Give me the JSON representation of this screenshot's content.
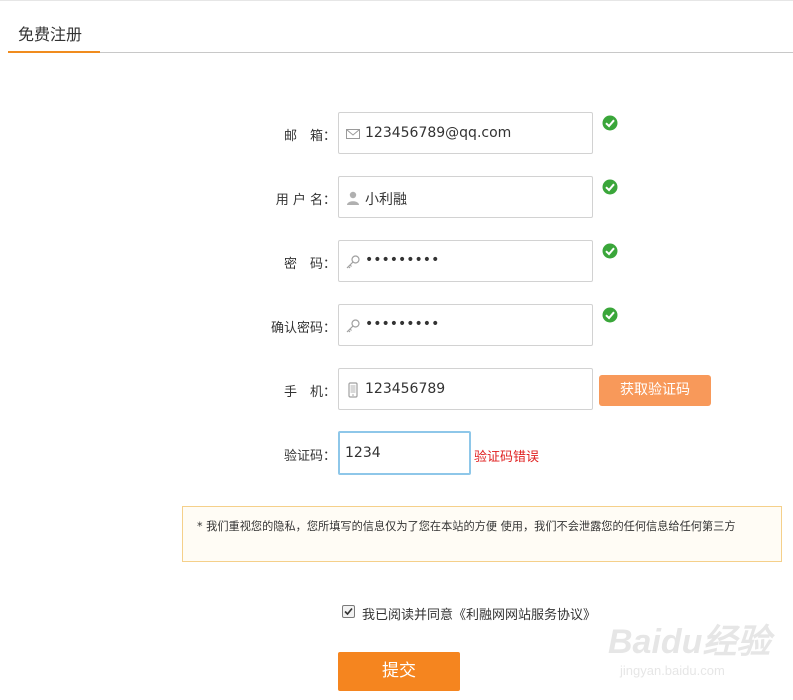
{
  "header": {
    "title": "免费注册"
  },
  "form": {
    "email": {
      "label": "邮　箱：",
      "value": "123456789@qq.com",
      "icon": "envelope-icon",
      "status": "valid"
    },
    "username": {
      "label": "用 户 名：",
      "value": "小利融",
      "icon": "user-icon",
      "status": "valid"
    },
    "password": {
      "label": "密　码：",
      "value": "•••••••••",
      "icon": "key-icon",
      "status": "valid"
    },
    "confirm_password": {
      "label": "确认密码：",
      "value": "•••••••••",
      "icon": "key-icon",
      "status": "valid"
    },
    "phone": {
      "label": "手　机：",
      "value": "123456789",
      "icon": "mobile-phone-icon",
      "button": "获取验证码"
    },
    "captcha": {
      "label": "验证码：",
      "value": "1234",
      "error": "验证码错误"
    }
  },
  "notice": {
    "text": "* 我们重视您的隐私，您所填写的信息仅为了您在本站的方便 使用，我们不会泄露您的任何信息给任何第三方"
  },
  "agreement": {
    "text": "我已阅读并同意《利融网网站服务协议》",
    "checked": true
  },
  "submit": {
    "label": "提交"
  },
  "watermark": {
    "logo": "Baidu经验",
    "url": "jingyan.baidu.com"
  },
  "colors": {
    "accent": "#f5851f",
    "sms_button": "#f8995a",
    "valid": "#3aa63a",
    "error": "#e02020",
    "focus": "#8ec7e9"
  }
}
